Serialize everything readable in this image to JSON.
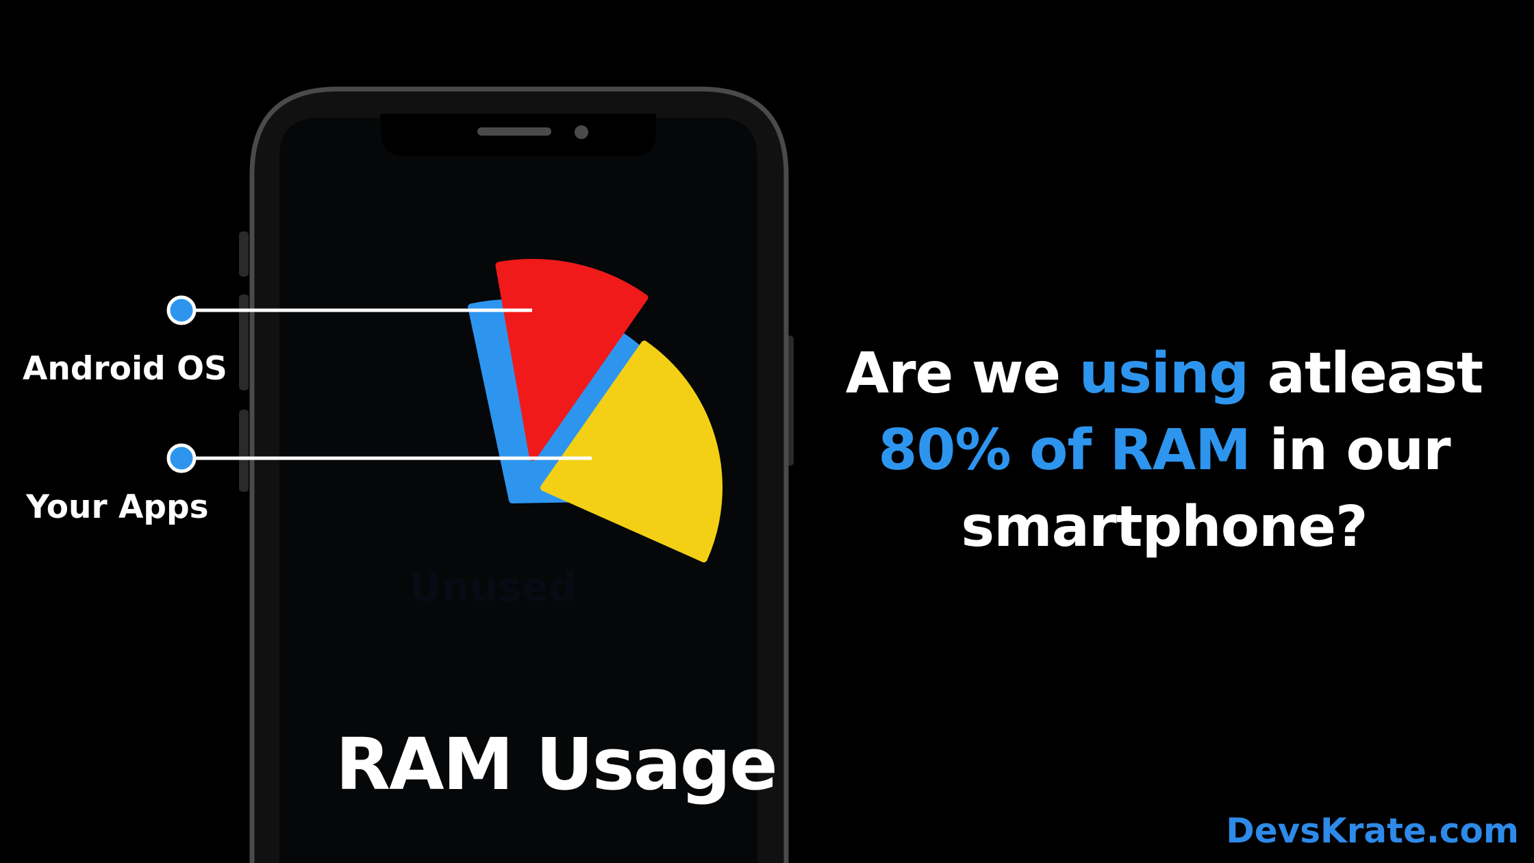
{
  "colors": {
    "background": "#000000",
    "unused": "#2e95ee",
    "android_os": "#f01a1a",
    "your_apps": "#f3d015",
    "highlight": "#2e95ee",
    "brand": "#2e8ae8"
  },
  "chart_data": {
    "type": "pie",
    "slices": [
      {
        "label": "Unused",
        "color": "#2e95ee",
        "exploded": false
      },
      {
        "label": "Android OS",
        "color": "#f01a1a",
        "exploded": true
      },
      {
        "label": "Your Apps",
        "color": "#f3d015",
        "exploded": true
      }
    ]
  },
  "callouts": {
    "android_os": "Android OS",
    "your_apps": "Your Apps"
  },
  "pie_inner_label": "Unused",
  "phone_caption": "RAM Usage",
  "headline": {
    "line1_a": "Are we ",
    "line1_b": "using",
    "line1_c": " atleast",
    "line2_a": "80% of RAM",
    "line2_b": " in our",
    "line3": "smartphone?"
  },
  "brand": "DevsKrate.com"
}
